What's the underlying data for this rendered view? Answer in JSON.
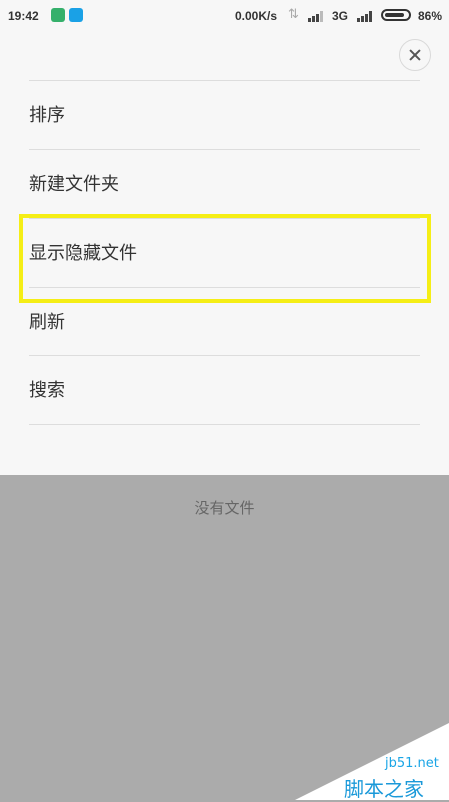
{
  "status_bar": {
    "time": "19:42",
    "net_speed": "0.00K/s",
    "network_type": "3G",
    "battery": "86%",
    "battery_level": 0.86,
    "icons": [
      "app-shield-icon",
      "app-drop-icon",
      "data-arrows-icon",
      "signal-icon",
      "battery-icon"
    ]
  },
  "menu": {
    "close_icon": "close-icon",
    "items": [
      {
        "label": "排序"
      },
      {
        "label": "新建文件夹"
      },
      {
        "label": "显示隐藏文件"
      },
      {
        "label": "刷新"
      },
      {
        "label": "搜索"
      }
    ],
    "highlight_color": "#f5ee16"
  },
  "content": {
    "empty_text": "没有文件"
  },
  "watermark": {
    "site": "jb51.net",
    "name": "脚本之家"
  }
}
